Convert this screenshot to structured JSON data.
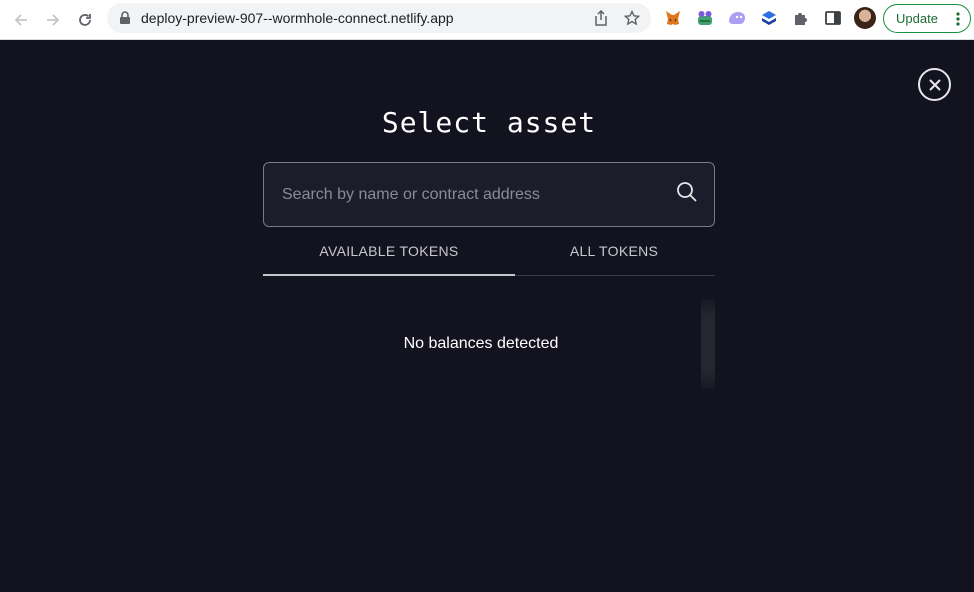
{
  "browser": {
    "url": "deploy-preview-907--wormhole-connect.netlify.app",
    "update_label": "Update",
    "extensions": [
      "fox-extension-icon",
      "frog-extension-icon",
      "ghost-extension-icon",
      "cube-extension-icon",
      "puzzle-extensions-icon",
      "side-panel-icon"
    ]
  },
  "modal": {
    "title": "Select asset",
    "search": {
      "placeholder": "Search by name or contract address",
      "value": ""
    },
    "tabs": [
      {
        "label": "AVAILABLE TOKENS",
        "active": true
      },
      {
        "label": "ALL TOKENS",
        "active": false
      }
    ],
    "empty_message": "No balances detected"
  },
  "colors": {
    "background": "#13121f",
    "update_green": "#1e8e3e"
  }
}
